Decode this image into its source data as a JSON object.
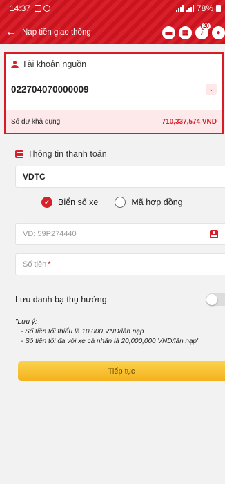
{
  "status_bar": {
    "time": "14:37",
    "battery": "78%"
  },
  "nav": {
    "back_icon": "arrow-left-icon",
    "title": "Nạp tiền giao thông",
    "notification_count": "20"
  },
  "source_account": {
    "heading": "Tài khoản nguồn",
    "account_number": "022704070000009",
    "balance_label": "Số dư khả dụng",
    "balance_value": "710,337,574 VND"
  },
  "payment_info": {
    "heading": "Thông tin thanh toán",
    "provider": "VDTC",
    "options": [
      {
        "label": "Biển số xe",
        "selected": true
      },
      {
        "label": "Mã hợp đồng",
        "selected": false
      }
    ],
    "plate_placeholder": "VD: 59P274440",
    "amount_placeholder": "Số tiền",
    "amount_required_mark": "*"
  },
  "save_beneficiary": {
    "label": "Lưu danh bạ thụ hưởng",
    "enabled": false
  },
  "note": {
    "title": "\"Lưu ý:",
    "lines": [
      "- Số tiền tối thiểu là 10,000 VND/lần nạp",
      "- Số tiền tối đa với xe cá nhân là 20,000,000 VND/lần nạp\""
    ]
  },
  "continue_button": "Tiếp tục",
  "colors": {
    "brand_red": "#d8202b",
    "button_yellow": "#f7c12e",
    "highlight_pink": "#fde9ea"
  }
}
